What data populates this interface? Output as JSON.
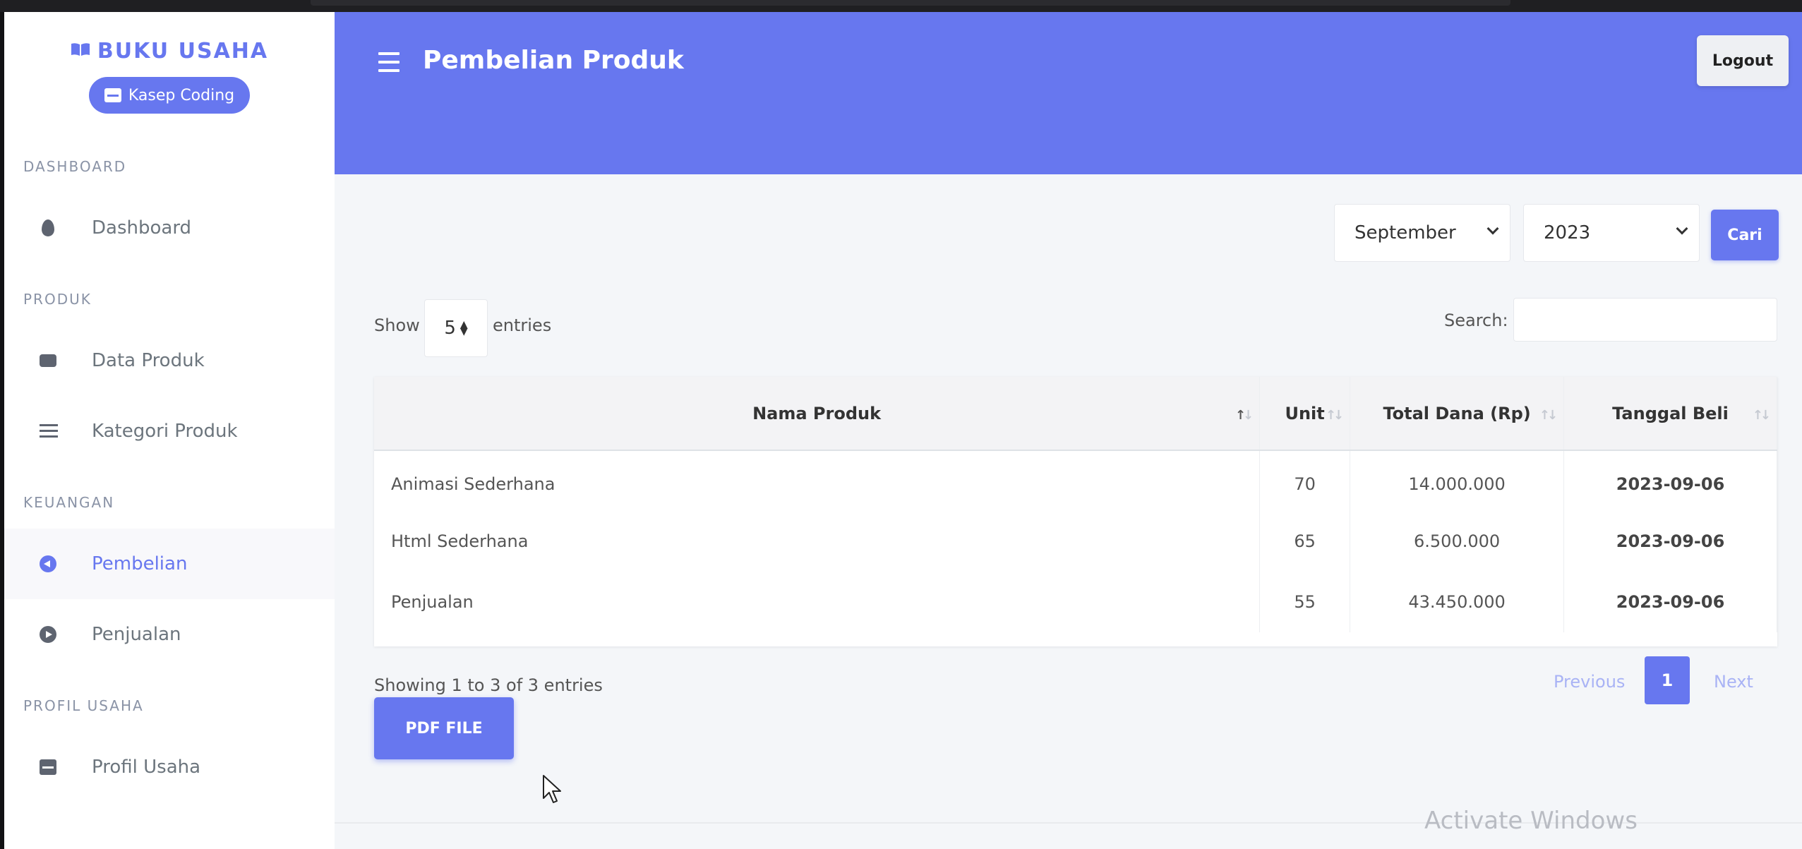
{
  "brand": {
    "title": "BUKU USAHA",
    "store": "Kasep Coding"
  },
  "sidebar": {
    "sections": [
      {
        "header": "DASHBOARD",
        "items": [
          {
            "label": "Dashboard",
            "icon": "fire-icon"
          }
        ]
      },
      {
        "header": "PRODUK",
        "items": [
          {
            "label": "Data Produk",
            "icon": "box-icon"
          },
          {
            "label": "Kategori Produk",
            "icon": "list-icon"
          }
        ]
      },
      {
        "header": "KEUANGAN",
        "items": [
          {
            "label": "Pembelian",
            "icon": "arrow-circle-left-icon",
            "active": true
          },
          {
            "label": "Penjualan",
            "icon": "arrow-circle-right-icon"
          }
        ]
      },
      {
        "header": "PROFIL USAHA",
        "items": [
          {
            "label": "Profil Usaha",
            "icon": "store-icon"
          }
        ]
      }
    ]
  },
  "header": {
    "title": "Pembelian Produk",
    "logout_label": "Logout"
  },
  "filter": {
    "month": "September",
    "year": "2023",
    "button_label": "Cari"
  },
  "table_controls": {
    "show_label": "Show",
    "entries_value": "5",
    "entries_label": "entries",
    "search_label": "Search:",
    "search_value": ""
  },
  "table": {
    "columns": [
      "Nama Produk",
      "Unit",
      "Total Dana (Rp)",
      "Tanggal Beli"
    ],
    "rows": [
      [
        "Animasi Sederhana",
        "70",
        "14.000.000",
        "2023-09-06"
      ],
      [
        "Html Sederhana",
        "65",
        "6.500.000",
        "2023-09-06"
      ],
      [
        "Penjualan",
        "55",
        "43.450.000",
        "2023-09-06"
      ]
    ]
  },
  "pagination": {
    "info": "Showing 1 to 3 of 3 entries",
    "previous": "Previous",
    "current": "1",
    "next": "Next"
  },
  "pdf_button": "PDF FILE",
  "watermark": "Activate Windows",
  "colors": {
    "primary": "#6777ef",
    "background": "#f4f6f9"
  }
}
